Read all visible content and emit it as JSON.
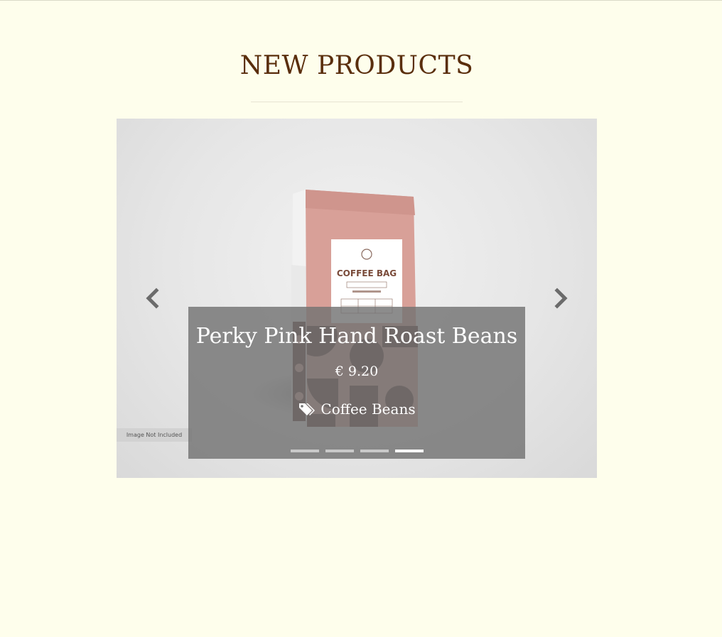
{
  "section": {
    "title": "NEW PRODUCTS"
  },
  "carousel": {
    "slide": {
      "image_alt": "Coffee bag product image",
      "image_note": "Image Not Included",
      "name": "Perky Pink Hand Roast Beans",
      "price": "€ 9.20",
      "category": "Coffee Beans"
    },
    "indicators_count": 4,
    "active_index": 3,
    "controls": {
      "prev_icon": "chevron-left-icon",
      "next_icon": "chevron-right-icon"
    }
  },
  "colors": {
    "background": "#fefeec",
    "title": "#5a2e0c",
    "bag_pink": "#d8a098",
    "bag_dark": "#5d3b33"
  }
}
